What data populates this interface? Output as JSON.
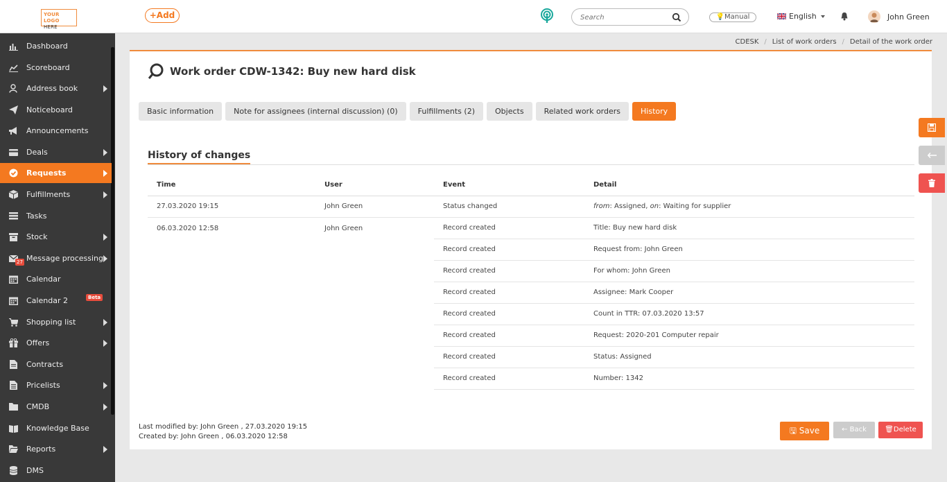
{
  "header": {
    "logo_line1": "YOUR LOGO",
    "logo_line2": "HERE",
    "add_label": "+Add",
    "search_placeholder": "Search",
    "manual_label": "Manual",
    "language": "English",
    "user_name": "John Green"
  },
  "sidebar": {
    "items": [
      {
        "label": "Dashboard",
        "icon": "bar-chart-icon"
      },
      {
        "label": "Scoreboard",
        "icon": "line-chart-icon"
      },
      {
        "label": "Address book",
        "icon": "user-icon"
      },
      {
        "label": "Noticeboard",
        "icon": "paper-plane-icon"
      },
      {
        "label": "Announcements",
        "icon": "megaphone-icon"
      },
      {
        "label": "Deals",
        "icon": "card-icon"
      },
      {
        "label": "Requests",
        "icon": "check-circle-icon"
      },
      {
        "label": "Fulfillments",
        "icon": "box-icon"
      },
      {
        "label": "Tasks",
        "icon": "list-icon"
      },
      {
        "label": "Stock",
        "icon": "archive-icon"
      },
      {
        "label": "Message processing",
        "icon": "envelope-icon",
        "badge": "27"
      },
      {
        "label": "Calendar",
        "icon": "calendar-icon"
      },
      {
        "label": "Calendar 2",
        "icon": "calendar-icon",
        "badge": "Beta"
      },
      {
        "label": "Shopping list",
        "icon": "cart-icon"
      },
      {
        "label": "Offers",
        "icon": "gift-icon"
      },
      {
        "label": "Contracts",
        "icon": "document-icon"
      },
      {
        "label": "Pricelists",
        "icon": "document-list-icon"
      },
      {
        "label": "CMDB",
        "icon": "folder-icon"
      },
      {
        "label": "Knowledge Base",
        "icon": "book-icon"
      },
      {
        "label": "Reports",
        "icon": "folder-open-icon"
      },
      {
        "label": "DMS",
        "icon": "database-icon"
      }
    ]
  },
  "breadcrumb": [
    "CDESK",
    "List of work orders",
    "Detail of the work order"
  ],
  "page": {
    "title": "Work order CDW-1342: Buy new hard disk",
    "tabs": [
      "Basic information",
      "Note for assignees (internal discussion) (0)",
      "Fulfillments (2)",
      "Objects",
      "Related work orders",
      "History"
    ],
    "section_title": "History of changes"
  },
  "history": {
    "headers": [
      "Time",
      "User",
      "Event",
      "Detail"
    ],
    "row1": {
      "time": "27.03.2020 19:15",
      "user": "John Green",
      "event": "Status changed",
      "from_label": "from",
      "from_value": ": Assigned, ",
      "on_label": "on",
      "on_value": ": Waiting for supplier"
    },
    "group_time": "06.03.2020 12:58",
    "group_user": "John Green",
    "events": [
      {
        "event": "Record created",
        "detail": "Title: Buy new hard disk"
      },
      {
        "event": "Record created",
        "detail": "Request from: John Green"
      },
      {
        "event": "Record created",
        "detail": "For whom: John Green"
      },
      {
        "event": "Record created",
        "detail": "Assignee: Mark Cooper"
      },
      {
        "event": "Record created",
        "detail": "Count in TTR: 07.03.2020 13:57"
      },
      {
        "event": "Record created",
        "detail": "Request: 2020-201 Computer repair"
      },
      {
        "event": "Record created",
        "detail": "Status: Assigned"
      },
      {
        "event": "Record created",
        "detail": "Number: 1342"
      }
    ]
  },
  "footer": {
    "last_modified": "Last modified by:  John Green , 27.03.2020 19:15",
    "created_by": "Created by:  John Green , 06.03.2020 12:58",
    "save_label": "Save",
    "back_label": "Back",
    "delete_label": "Delete"
  },
  "colors": {
    "accent": "#f47920",
    "sidebar": "#393939",
    "delete": "#ef5350",
    "teal": "#1aa89c"
  }
}
